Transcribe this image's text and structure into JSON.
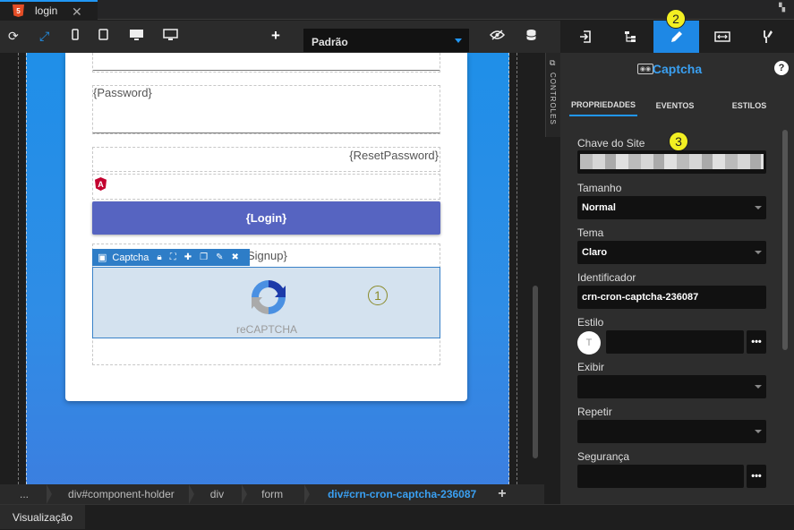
{
  "tab": {
    "title": "login",
    "icon": "html5-icon",
    "close": "✕"
  },
  "toolbar": {
    "icons": [
      "refresh-icon",
      "expand-icon",
      "phone-icon",
      "tablet-icon",
      "desktop-icon",
      "monitor-icon"
    ],
    "add": "+",
    "device_select": "Padrão"
  },
  "canvas": {
    "password_placeholder": "{Password}",
    "reset_password": "{ResetPassword}",
    "login_button": "{Login}",
    "signup": "Signup}",
    "captcha_toolbar_label": "Captcha",
    "recaptcha_text": "reCAPTCHA",
    "badge1": "1",
    "controls_label": "CONTROLES"
  },
  "breadcrumb": [
    "...",
    "div#component-holder",
    "div",
    "form",
    "div#crn-cron-captcha-236087"
  ],
  "bottom_tab": "Visualização",
  "panel": {
    "badge2": "2",
    "title": "Captcha",
    "help": "?",
    "subtabs": [
      "PROPRIEDADES",
      "EVENTOS",
      "ESTILOS"
    ],
    "badge3": "3",
    "fields": {
      "chave_label": "Chave do Site",
      "tamanho_label": "Tamanho",
      "tamanho_value": "Normal",
      "tema_label": "Tema",
      "tema_value": "Claro",
      "identificador_label": "Identificador",
      "identificador_value": "crn-cron-captcha-236087",
      "estilo_label": "Estilo",
      "exibir_label": "Exibir",
      "repetir_label": "Repetir",
      "seguranca_label": "Segurança"
    },
    "dots": "•••"
  },
  "colors": {
    "accent": "#1e88e5",
    "captcha_select": "#3a82c8",
    "badge": "#e6e64a",
    "login_btn": "#5664c1"
  }
}
